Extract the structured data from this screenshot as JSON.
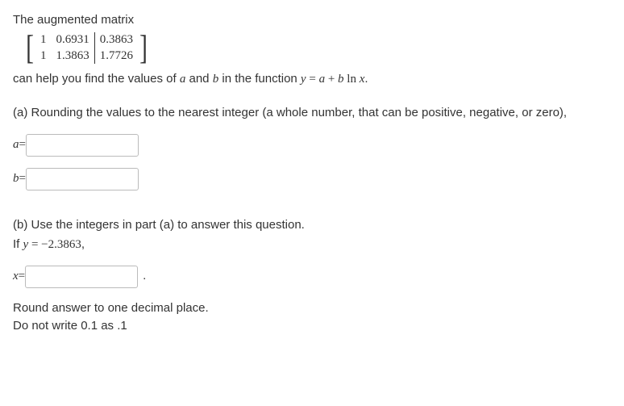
{
  "intro": {
    "line1": "The augmented matrix",
    "line2_pre": "can help you find the values of ",
    "line2_a": "a",
    "line2_mid": " and ",
    "line2_b": "b",
    "line2_post": " in the function ",
    "line2_eqY": "y",
    "line2_eqEq": " = ",
    "line2_eqA": "a",
    "line2_eqPlus": " + ",
    "line2_eqB": "b",
    "line2_eqLn": " ln ",
    "line2_eqX": "x",
    "line2_period": "."
  },
  "matrix": {
    "r1c1": "1",
    "r1c2": "0.6931",
    "r1c3": "0.3863",
    "r2c1": "1",
    "r2c2": "1.3863",
    "r2c3": "1.7726"
  },
  "partA": {
    "prompt": "(a) Rounding the values to the nearest integer (a whole number, that can be positive, negative, or zero),",
    "label_a": "a",
    "label_eq": "=",
    "label_b": "b",
    "value_a": "",
    "value_b": ""
  },
  "partB": {
    "prompt": "(b) Use the integers in part (a) to answer this question.",
    "ifText_pre": "If ",
    "ifText_y": "y",
    "ifText_eq": " = ",
    "ifText_val": "−2.3863",
    "ifText_comma": ",",
    "label_x": "x",
    "label_eq": "=",
    "value_x": "",
    "period": ".",
    "hint1": "Round answer to one decimal place.",
    "hint2": "Do not write 0.1 as .1"
  }
}
